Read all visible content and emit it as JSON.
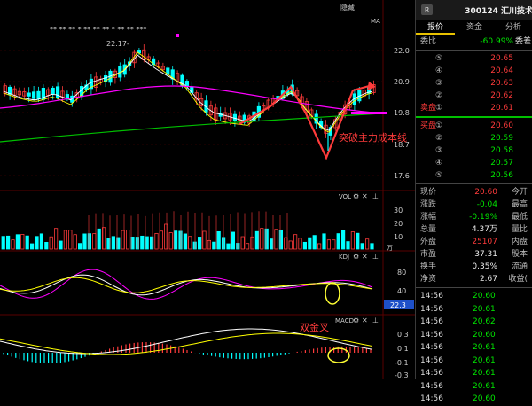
{
  "top": {
    "hide_label": "隐藏",
    "ma_label": "MA",
    "stars": "**  **                  **  *  **     **  **     *  **  **  ***",
    "high_label": "22.17-"
  },
  "price_axis": [
    "22.0",
    "20.9",
    "19.8",
    "18.7",
    "17.6"
  ],
  "annotations": {
    "breakout": "突破主力成本线",
    "double_golden": "双金叉"
  },
  "panels": {
    "vol": {
      "name": "VOL",
      "ticks": [
        "30",
        "20",
        "10"
      ],
      "unit": "万"
    },
    "kdj": {
      "name": "KDJ",
      "ticks": [
        "80",
        "40"
      ],
      "current": "22.3"
    },
    "macd": {
      "name": "MACD",
      "ticks": [
        "0.3",
        "0.1",
        "-0.1",
        "-0.3"
      ]
    }
  },
  "panel_icons": [
    "gear-icon",
    "close-icon"
  ],
  "sidebar": {
    "badge": "R",
    "code_name": "300124 汇川技术",
    "tabs": [
      "报价",
      "资金",
      "分析"
    ],
    "weibi_label": "委比",
    "weibi_value": "-60.99%",
    "weicha_label": "委差",
    "sell": [
      {
        "n": "⑤",
        "price": "20.65",
        "vol": ""
      },
      {
        "n": "④",
        "price": "20.64",
        "vol": ""
      },
      {
        "n": "③",
        "price": "20.63",
        "vol": ""
      },
      {
        "n": "②",
        "price": "20.62",
        "vol": ""
      },
      {
        "n": "①",
        "price": "20.61",
        "vol": ""
      }
    ],
    "sell_label": "卖盘",
    "buy_label": "买盘",
    "buy": [
      {
        "n": "①",
        "price": "20.60",
        "vol": ""
      },
      {
        "n": "②",
        "price": "20.59",
        "vol": ""
      },
      {
        "n": "③",
        "price": "20.58",
        "vol": ""
      },
      {
        "n": "④",
        "price": "20.57",
        "vol": ""
      },
      {
        "n": "⑤",
        "price": "20.56",
        "vol": ""
      }
    ],
    "stats": [
      {
        "l": "现价",
        "v": "20.60",
        "r": "今开",
        "c": "red"
      },
      {
        "l": "涨跌",
        "v": "-0.04",
        "r": "最高",
        "c": "grn"
      },
      {
        "l": "涨幅",
        "v": "-0.19%",
        "r": "最低",
        "c": "grn"
      },
      {
        "l": "总量",
        "v": "4.37万",
        "r": "量比",
        "c": "wht"
      },
      {
        "l": "外盘",
        "v": "25107",
        "r": "内盘",
        "c": "red"
      },
      {
        "l": "市盈",
        "v": "37.31",
        "r": "股本",
        "c": "wht"
      },
      {
        "l": "换手",
        "v": "0.35%",
        "r": "流通",
        "c": "wht"
      },
      {
        "l": "净资",
        "v": "2.67",
        "r": "收益(",
        "c": "wht"
      }
    ],
    "ticks": [
      {
        "t": "14:56",
        "p": "20.60",
        "v": ""
      },
      {
        "t": "14:56",
        "p": "20.61",
        "v": ""
      },
      {
        "t": "14:56",
        "p": "20.62",
        "v": ""
      },
      {
        "t": "14:56",
        "p": "20.60",
        "v": ""
      },
      {
        "t": "14:56",
        "p": "20.61",
        "v": ""
      },
      {
        "t": "14:56",
        "p": "20.61",
        "v": ""
      },
      {
        "t": "14:56",
        "p": "20.61",
        "v": ""
      },
      {
        "t": "14:56",
        "p": "20.61",
        "v": ""
      },
      {
        "t": "14:56",
        "p": "20.60",
        "v": ""
      }
    ]
  },
  "colors": {
    "up": "#ff3b3b",
    "down": "#00ffff",
    "ma1": "#ffffff",
    "ma2": "#ffff00",
    "ma3": "#ff00ff",
    "ma4": "#00c000",
    "arrow": "#ff3b3b",
    "note": "#ff3b3b",
    "circle": "#ffff00"
  }
}
